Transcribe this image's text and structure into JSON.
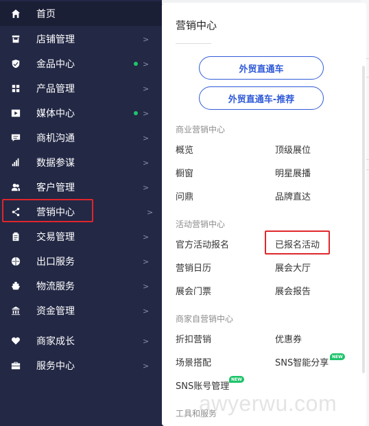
{
  "sidebar": {
    "items": [
      {
        "label": "首页",
        "icon": "home-icon",
        "dot": false
      },
      {
        "label": "店铺管理",
        "icon": "store-icon",
        "dot": false
      },
      {
        "label": "金品中心",
        "icon": "shield-icon",
        "dot": true
      },
      {
        "label": "产品管理",
        "icon": "grid-icon",
        "dot": false
      },
      {
        "label": "媒体中心",
        "icon": "media-icon",
        "dot": true
      },
      {
        "label": "商机沟通",
        "icon": "chat-icon",
        "dot": false
      },
      {
        "label": "数据参谋",
        "icon": "bar-chart-icon",
        "dot": false
      },
      {
        "label": "客户管理",
        "icon": "users-icon",
        "dot": false
      },
      {
        "label": "营销中心",
        "icon": "share-icon",
        "dot": false,
        "active": true
      },
      {
        "label": "交易管理",
        "icon": "clipboard-icon",
        "dot": false
      },
      {
        "label": "出口服务",
        "icon": "globe-icon",
        "dot": false
      },
      {
        "label": "物流服务",
        "icon": "ship-icon",
        "dot": false
      },
      {
        "label": "资金管理",
        "icon": "bank-icon",
        "dot": false
      },
      {
        "label": "商家成长",
        "icon": "heart-icon",
        "dot": false
      },
      {
        "label": "服务中心",
        "icon": "briefcase-icon",
        "dot": false
      }
    ],
    "arrow": ">"
  },
  "panel": {
    "title": "营销中心",
    "pill_primary": "外贸直通车",
    "pill_secondary": "外贸直通车-推荐",
    "sections": [
      {
        "heading": "商业营销中心",
        "links": [
          "概览",
          "顶级展位",
          "橱窗",
          "明星展播",
          "问鼎",
          "品牌直达"
        ]
      },
      {
        "heading": "活动营销中心",
        "links": [
          "官方活动报名",
          "已报名活动",
          "营销日历",
          "展会大厅",
          "展会门票",
          "展会报告"
        ]
      },
      {
        "heading": "商家自营销中心",
        "links": [
          "折扣营销",
          "优惠券",
          "场景搭配",
          "SNS智能分享",
          "SNS账号管理"
        ]
      },
      {
        "heading": "工具和服务"
      }
    ],
    "new_badge": "NEW"
  },
  "watermark": "awyerwu.com",
  "colors": {
    "sidebar_bg": "#232845",
    "accent_blue": "#2f5ad8",
    "highlight_red": "#e0262b",
    "dot_green": "#1fc66b"
  }
}
